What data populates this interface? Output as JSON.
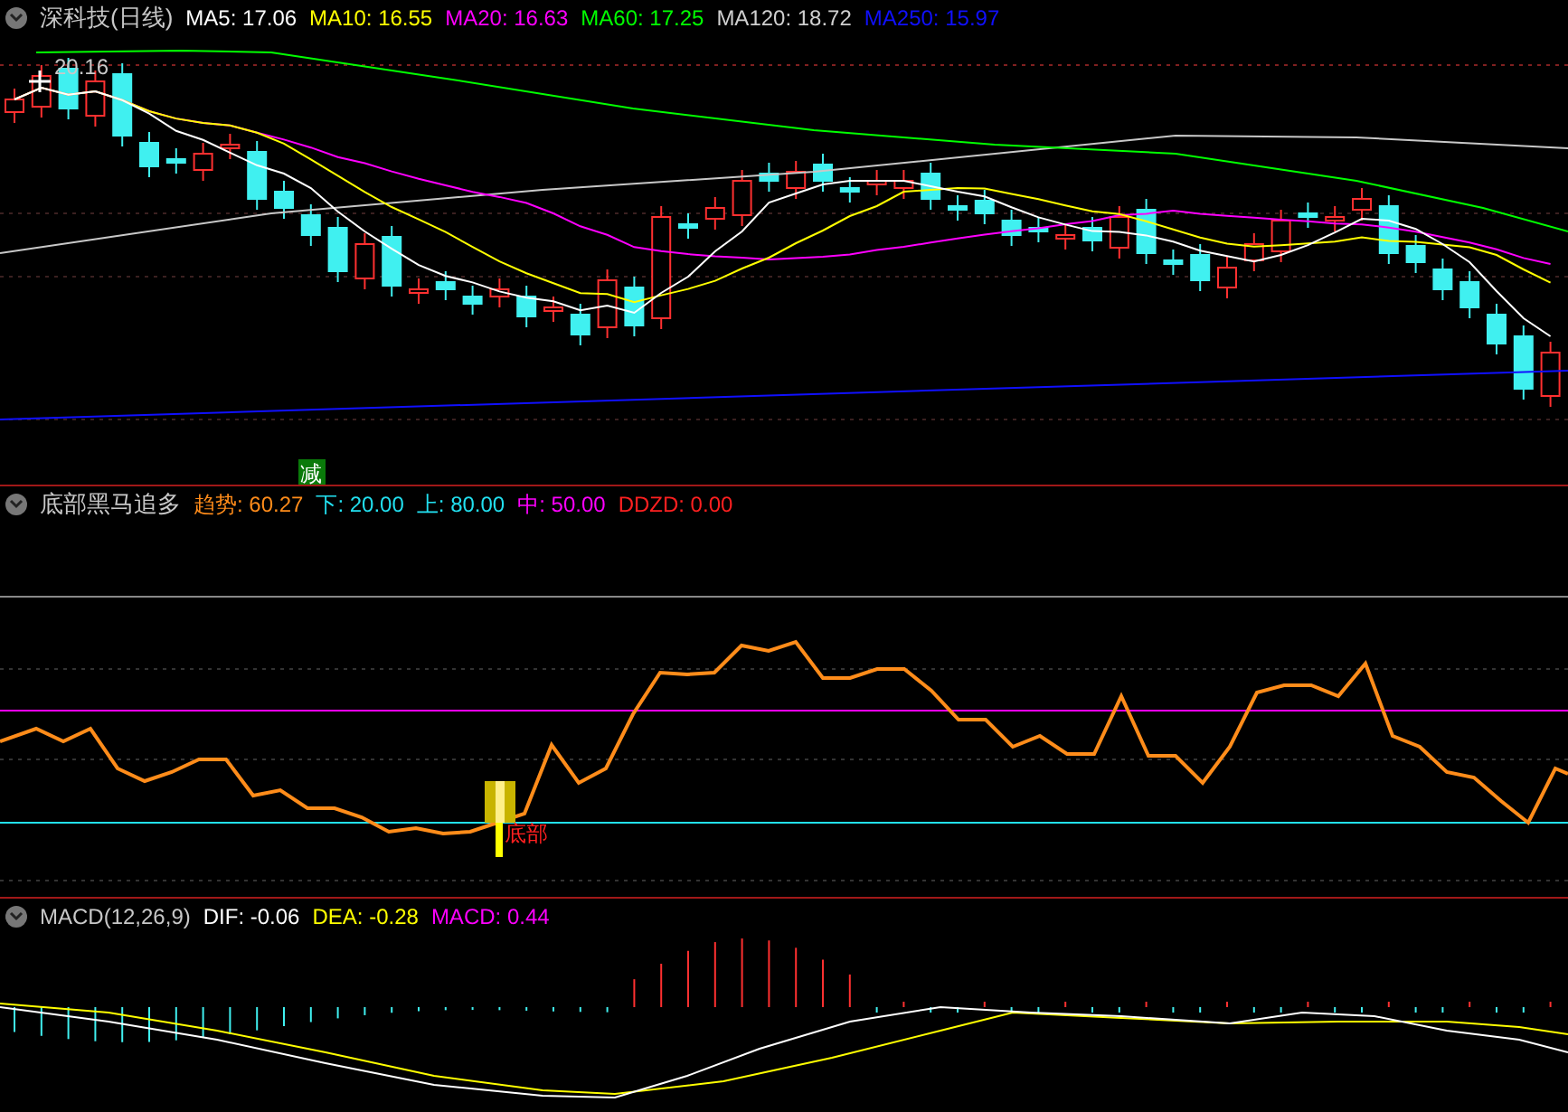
{
  "main_panel": {
    "title": "深科技(日线)",
    "legend": [
      {
        "label": "MA5: 17.06",
        "color": "#ffffff"
      },
      {
        "label": "MA10: 16.55",
        "color": "#ffff00"
      },
      {
        "label": "MA20: 16.63",
        "color": "#ff00ff"
      },
      {
        "label": "MA60: 17.25",
        "color": "#00ff00"
      },
      {
        "label": "MA120: 18.72",
        "color": "#d0d0d0"
      },
      {
        "label": "MA250: 15.97",
        "color": "#1010ff"
      }
    ],
    "high_label": "20.16",
    "signal_label": "减"
  },
  "indicator_panel": {
    "title": "底部黑马追多",
    "legend": [
      {
        "label": "趋势: 60.27",
        "color": "#ff8c1a"
      },
      {
        "label": "下: 20.00",
        "color": "#22e0f0"
      },
      {
        "label": "上: 80.00",
        "color": "#22e0f0"
      },
      {
        "label": "中: 50.00",
        "color": "#ff00ff"
      },
      {
        "label": "DDZD: 0.00",
        "color": "#ff2020"
      }
    ],
    "signal_label": "底部"
  },
  "macd_panel": {
    "title": "MACD(12,26,9)",
    "legend": [
      {
        "label": "DIF: -0.06",
        "color": "#ffffff"
      },
      {
        "label": "DEA: -0.28",
        "color": "#ffff00"
      },
      {
        "label": "MACD: 0.44",
        "color": "#ff00ff"
      }
    ]
  }
}
